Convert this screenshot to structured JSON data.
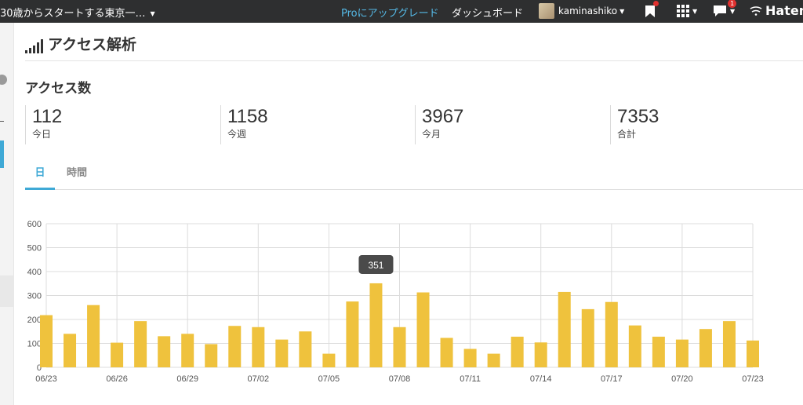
{
  "topbar": {
    "blog_title": "30歳からスタートする東京一…",
    "pro_link": "Proにアップグレード",
    "dashboard_link": "ダッシュボード",
    "user_name": "kaminashiko",
    "comment_badge": "1",
    "brand": "Haten",
    "colors": {
      "background": "#2e2f30",
      "pro_link": "#55b9e6",
      "badge": "#e0312f"
    }
  },
  "page": {
    "title": "アクセス解析",
    "section_title": "アクセス数"
  },
  "stats": [
    {
      "value": "112",
      "label": "今日"
    },
    {
      "value": "1158",
      "label": "今週"
    },
    {
      "value": "3967",
      "label": "今月"
    },
    {
      "value": "7353",
      "label": "合計"
    }
  ],
  "tabs": [
    {
      "label": "日",
      "active": true
    },
    {
      "label": "時間",
      "active": false
    }
  ],
  "chart_data": {
    "type": "bar",
    "bar_color": "#efc23d",
    "ylim": [
      0,
      600
    ],
    "y_ticks": [
      "0",
      "100",
      "200",
      "300",
      "400",
      "500",
      "600"
    ],
    "categories": [
      "06/23",
      "06/24",
      "06/25",
      "06/26",
      "06/27",
      "06/28",
      "06/29",
      "06/30",
      "07/01",
      "07/02",
      "07/03",
      "07/04",
      "07/05",
      "07/06",
      "07/07",
      "07/08",
      "07/09",
      "07/10",
      "07/11",
      "07/12",
      "07/13",
      "07/14",
      "07/15",
      "07/16",
      "07/17",
      "07/18",
      "07/19",
      "07/20",
      "07/21",
      "07/22",
      "07/23"
    ],
    "x_tick_labels": [
      "06/23",
      "06/26",
      "06/29",
      "07/02",
      "07/05",
      "07/08",
      "07/11",
      "07/14",
      "07/17",
      "07/20",
      "07/23"
    ],
    "values": [
      218,
      140,
      260,
      103,
      193,
      130,
      140,
      97,
      173,
      168,
      116,
      150,
      57,
      275,
      351,
      168,
      313,
      123,
      77,
      57,
      128,
      104,
      315,
      243,
      273,
      175,
      128,
      116,
      160,
      193,
      112
    ],
    "tooltip": {
      "category": "07/07",
      "text": "351"
    },
    "grid": true
  }
}
